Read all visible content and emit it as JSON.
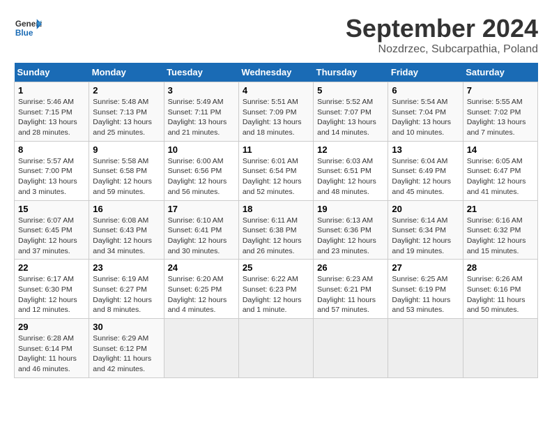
{
  "header": {
    "logo_line1": "General",
    "logo_line2": "Blue",
    "title": "September 2024",
    "subtitle": "Nozdrzec, Subcarpathia, Poland"
  },
  "days_of_week": [
    "Sunday",
    "Monday",
    "Tuesday",
    "Wednesday",
    "Thursday",
    "Friday",
    "Saturday"
  ],
  "weeks": [
    [
      {
        "day": "1",
        "info": "Sunrise: 5:46 AM\nSunset: 7:15 PM\nDaylight: 13 hours\nand 28 minutes."
      },
      {
        "day": "2",
        "info": "Sunrise: 5:48 AM\nSunset: 7:13 PM\nDaylight: 13 hours\nand 25 minutes."
      },
      {
        "day": "3",
        "info": "Sunrise: 5:49 AM\nSunset: 7:11 PM\nDaylight: 13 hours\nand 21 minutes."
      },
      {
        "day": "4",
        "info": "Sunrise: 5:51 AM\nSunset: 7:09 PM\nDaylight: 13 hours\nand 18 minutes."
      },
      {
        "day": "5",
        "info": "Sunrise: 5:52 AM\nSunset: 7:07 PM\nDaylight: 13 hours\nand 14 minutes."
      },
      {
        "day": "6",
        "info": "Sunrise: 5:54 AM\nSunset: 7:04 PM\nDaylight: 13 hours\nand 10 minutes."
      },
      {
        "day": "7",
        "info": "Sunrise: 5:55 AM\nSunset: 7:02 PM\nDaylight: 13 hours\nand 7 minutes."
      }
    ],
    [
      {
        "day": "8",
        "info": "Sunrise: 5:57 AM\nSunset: 7:00 PM\nDaylight: 13 hours\nand 3 minutes."
      },
      {
        "day": "9",
        "info": "Sunrise: 5:58 AM\nSunset: 6:58 PM\nDaylight: 12 hours\nand 59 minutes."
      },
      {
        "day": "10",
        "info": "Sunrise: 6:00 AM\nSunset: 6:56 PM\nDaylight: 12 hours\nand 56 minutes."
      },
      {
        "day": "11",
        "info": "Sunrise: 6:01 AM\nSunset: 6:54 PM\nDaylight: 12 hours\nand 52 minutes."
      },
      {
        "day": "12",
        "info": "Sunrise: 6:03 AM\nSunset: 6:51 PM\nDaylight: 12 hours\nand 48 minutes."
      },
      {
        "day": "13",
        "info": "Sunrise: 6:04 AM\nSunset: 6:49 PM\nDaylight: 12 hours\nand 45 minutes."
      },
      {
        "day": "14",
        "info": "Sunrise: 6:05 AM\nSunset: 6:47 PM\nDaylight: 12 hours\nand 41 minutes."
      }
    ],
    [
      {
        "day": "15",
        "info": "Sunrise: 6:07 AM\nSunset: 6:45 PM\nDaylight: 12 hours\nand 37 minutes."
      },
      {
        "day": "16",
        "info": "Sunrise: 6:08 AM\nSunset: 6:43 PM\nDaylight: 12 hours\nand 34 minutes."
      },
      {
        "day": "17",
        "info": "Sunrise: 6:10 AM\nSunset: 6:41 PM\nDaylight: 12 hours\nand 30 minutes."
      },
      {
        "day": "18",
        "info": "Sunrise: 6:11 AM\nSunset: 6:38 PM\nDaylight: 12 hours\nand 26 minutes."
      },
      {
        "day": "19",
        "info": "Sunrise: 6:13 AM\nSunset: 6:36 PM\nDaylight: 12 hours\nand 23 minutes."
      },
      {
        "day": "20",
        "info": "Sunrise: 6:14 AM\nSunset: 6:34 PM\nDaylight: 12 hours\nand 19 minutes."
      },
      {
        "day": "21",
        "info": "Sunrise: 6:16 AM\nSunset: 6:32 PM\nDaylight: 12 hours\nand 15 minutes."
      }
    ],
    [
      {
        "day": "22",
        "info": "Sunrise: 6:17 AM\nSunset: 6:30 PM\nDaylight: 12 hours\nand 12 minutes."
      },
      {
        "day": "23",
        "info": "Sunrise: 6:19 AM\nSunset: 6:27 PM\nDaylight: 12 hours\nand 8 minutes."
      },
      {
        "day": "24",
        "info": "Sunrise: 6:20 AM\nSunset: 6:25 PM\nDaylight: 12 hours\nand 4 minutes."
      },
      {
        "day": "25",
        "info": "Sunrise: 6:22 AM\nSunset: 6:23 PM\nDaylight: 12 hours\nand 1 minute."
      },
      {
        "day": "26",
        "info": "Sunrise: 6:23 AM\nSunset: 6:21 PM\nDaylight: 11 hours\nand 57 minutes."
      },
      {
        "day": "27",
        "info": "Sunrise: 6:25 AM\nSunset: 6:19 PM\nDaylight: 11 hours\nand 53 minutes."
      },
      {
        "day": "28",
        "info": "Sunrise: 6:26 AM\nSunset: 6:16 PM\nDaylight: 11 hours\nand 50 minutes."
      }
    ],
    [
      {
        "day": "29",
        "info": "Sunrise: 6:28 AM\nSunset: 6:14 PM\nDaylight: 11 hours\nand 46 minutes."
      },
      {
        "day": "30",
        "info": "Sunrise: 6:29 AM\nSunset: 6:12 PM\nDaylight: 11 hours\nand 42 minutes."
      },
      {
        "day": "",
        "info": ""
      },
      {
        "day": "",
        "info": ""
      },
      {
        "day": "",
        "info": ""
      },
      {
        "day": "",
        "info": ""
      },
      {
        "day": "",
        "info": ""
      }
    ]
  ]
}
